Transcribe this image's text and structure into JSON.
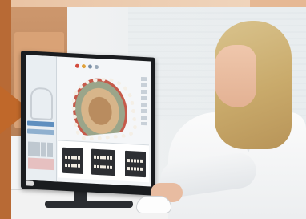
{
  "scene": {
    "description_tags": [
      "dental-cad-software",
      "monitor",
      "woman",
      "mouse",
      "desk"
    ]
  },
  "screen_ui": {
    "sidebar_title": "",
    "sidebar_items": [
      "",
      ""
    ],
    "brand_colors": {
      "accent": "#c0682a",
      "ui_blue": "#5f8fbf"
    }
  }
}
